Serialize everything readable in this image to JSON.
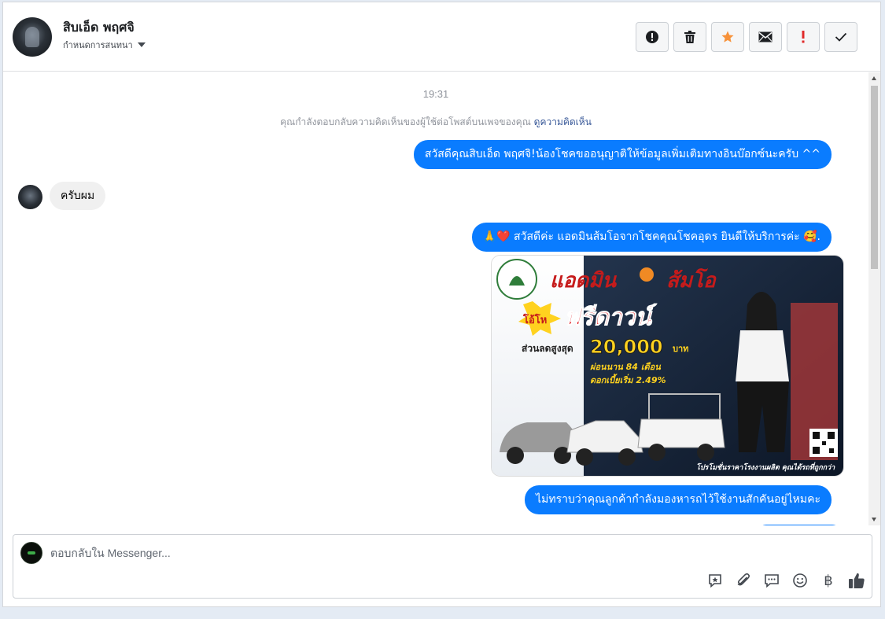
{
  "conversation": {
    "contact_name": "สิบเอ็ด พฤศจิ",
    "assign_label": "กำหนดการสนทนา"
  },
  "actions": [
    {
      "name": "mark-spam-button",
      "icon": "exclamation-circle-icon"
    },
    {
      "name": "delete-button",
      "icon": "trash-icon"
    },
    {
      "name": "star-button",
      "icon": "star-icon",
      "color": "#f7923a"
    },
    {
      "name": "mark-unread-button",
      "icon": "envelope-icon"
    },
    {
      "name": "follow-up-button",
      "icon": "exclamation-icon",
      "color": "#e02a2a"
    },
    {
      "name": "mark-done-button",
      "icon": "check-icon"
    }
  ],
  "thread": {
    "timestamp": "19:31",
    "context_text": "คุณกำลังตอบกลับความคิดเห็นของผู้ใช้ต่อโพสต์บนเพจของคุณ",
    "context_link": "ดูความคิดเห็น",
    "messages": [
      {
        "direction": "out",
        "text": "สวัสดีคุณสิบเอ็ด พฤศจิ!น้องโชคขออนุญาติให้ข้อมูลเพิ่มเติมทางอินบ๊อกซ์นะครับ ^^"
      },
      {
        "direction": "in",
        "text": "ครับผม"
      },
      {
        "direction": "out",
        "text": "🙏❤️ สวัสดีค่ะ แอดมินส้มโอจากโชคคุณโชคอุดร ยินดีให้บริการค่ะ 🥰."
      },
      {
        "direction": "out",
        "text": "ไม่ทราบว่าคุณลูกค้ากำลังมองหารถไว้ใช้งานสักคันอยู่ไหมคะ"
      }
    ],
    "promo": {
      "headline": "แอดมิน",
      "headline2": "ส้มโอ",
      "badge": "โอ้โห",
      "free_down": "ฟรีดาวน์",
      "discount_label": "ส่วนลดสูงสุด",
      "discount_value": "20,000",
      "discount_unit": "บาท",
      "term": "ผ่อนนาน 84 เดือน",
      "rate": "ดอกเบี้ยเริ่ม 2.49%",
      "footer": "โปรโมชั่นราคาโรงงานผลิต คุณได้รถที่ถูกกว่า"
    }
  },
  "composer": {
    "placeholder": "ตอบกลับใน Messenger...",
    "tools": [
      "saved-reply-icon",
      "attachment-icon",
      "chat-bubble-icon",
      "emoji-icon",
      "baht-icon",
      "thumbs-up-icon"
    ],
    "baht_symbol": "฿"
  },
  "colors": {
    "accent": "#0a7cff",
    "incoming_bubble": "#f0f0f0",
    "star": "#f7923a",
    "alert": "#e02a2a"
  }
}
